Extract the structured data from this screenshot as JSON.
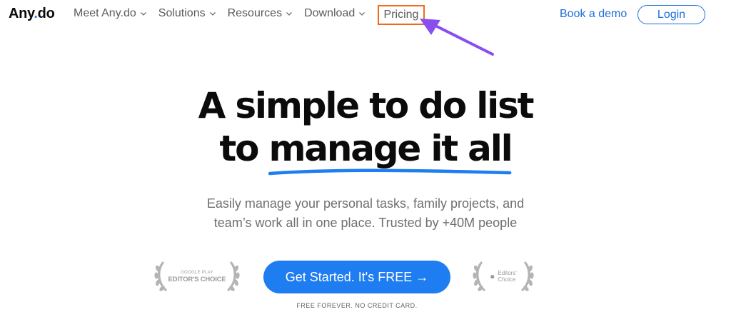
{
  "nav": {
    "logo_main": "Any",
    "logo_dot": ".",
    "logo_tail": "do",
    "items": [
      {
        "label": "Meet Any.do"
      },
      {
        "label": "Solutions"
      },
      {
        "label": "Resources"
      },
      {
        "label": "Download"
      }
    ],
    "pricing": "Pricing",
    "book_demo": "Book a demo",
    "login": "Login"
  },
  "hero": {
    "line1": "A simple to do list",
    "line2_prefix": "to ",
    "line2_highlight": "manage it all",
    "sub_line1": "Easily manage your personal tasks, family projects, and",
    "sub_line2": "team’s work all in one place. Trusted by +40M people",
    "cta": "Get Started. It's FREE →",
    "fine_print": "FREE FOREVER. NO CREDIT CARD."
  },
  "badges": {
    "google_small": "GOOGLE PLAY",
    "google_big": "EDITOR'S CHOICE",
    "apple_line1": "Editors'",
    "apple_line2": "Choice"
  },
  "colors": {
    "accent": "#1e7df0",
    "highlight_box": "#ef6a1a",
    "annotation_arrow": "#8a4df0"
  }
}
